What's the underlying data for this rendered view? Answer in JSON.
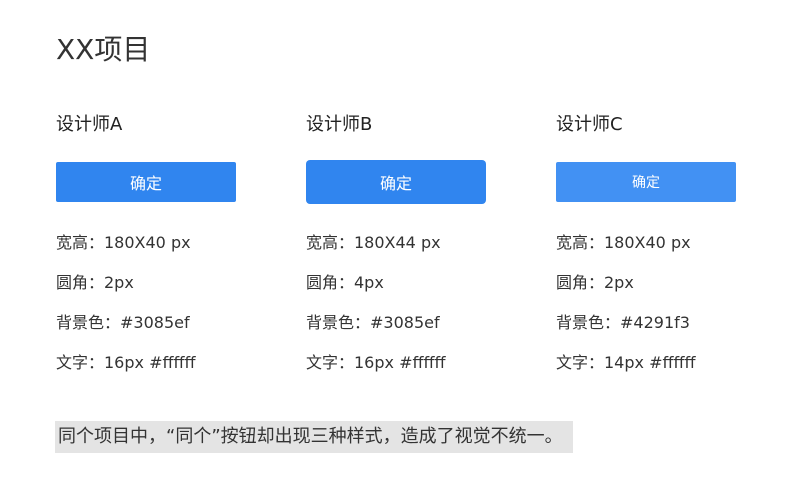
{
  "page_title": "XX项目",
  "designers": [
    {
      "name": "设计师A",
      "button_label": "确定",
      "button_color": "#3085ef",
      "specs": [
        "宽高：180X40 px",
        "圆角：2px",
        "背景色：#3085ef",
        "文字：16px #ffffff"
      ]
    },
    {
      "name": "设计师B",
      "button_label": "确定",
      "button_color": "#3085ef",
      "specs": [
        "宽高：180X44 px",
        "圆角：4px",
        "背景色：#3085ef",
        "文字：16px #ffffff"
      ]
    },
    {
      "name": "设计师C",
      "button_label": "确定",
      "button_color": "#4291f3",
      "specs": [
        "宽高：180X40 px",
        "圆角：2px",
        "背景色：#4291f3",
        "文字：14px #ffffff"
      ]
    }
  ],
  "note": "同个项目中，“同个”按钮却出现三种样式，造成了视觉不统一。"
}
